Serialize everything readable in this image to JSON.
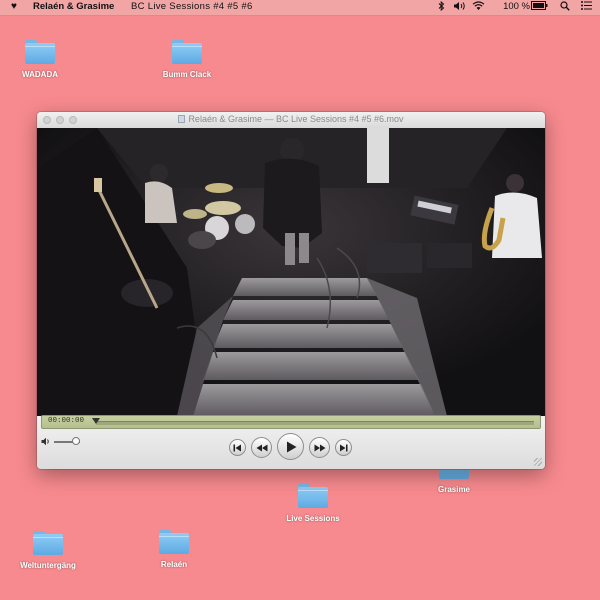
{
  "menubar": {
    "apple_glyph": "♥",
    "app_name": "Relaén & Grasime",
    "document_title": "BC  Live  Sessions  #4  #5  #6",
    "battery_percent": "100 %",
    "status_icons": [
      "bluetooth-icon",
      "volume-icon",
      "wifi-icon",
      "battery-icon",
      "search-icon",
      "list-icon"
    ]
  },
  "desktop": {
    "icons": [
      {
        "label": "WADADA"
      },
      {
        "label": "Bumm Clack"
      },
      {
        "label": "Grasime"
      },
      {
        "label": "Live Sessions"
      },
      {
        "label": "Weltuntergäng"
      },
      {
        "label": "Relaén"
      }
    ]
  },
  "window": {
    "title": "Relaén & Grasime  —  BC Live Sessions #4 #5 #6.mov",
    "timecode": "00:00:00",
    "playback_position": 0,
    "volume_level": 0.85,
    "controls": {
      "skip_back_glyph": "⏮",
      "rewind_glyph": "◀◀",
      "play_glyph": "▶",
      "fast_forward_glyph": "▶▶",
      "skip_forward_glyph": "⏭"
    },
    "volume_glyph": "🔈"
  },
  "colors": {
    "desktop": "#f78a8e",
    "folder": "#74b7e7",
    "timeline": "#c6cfa2"
  }
}
